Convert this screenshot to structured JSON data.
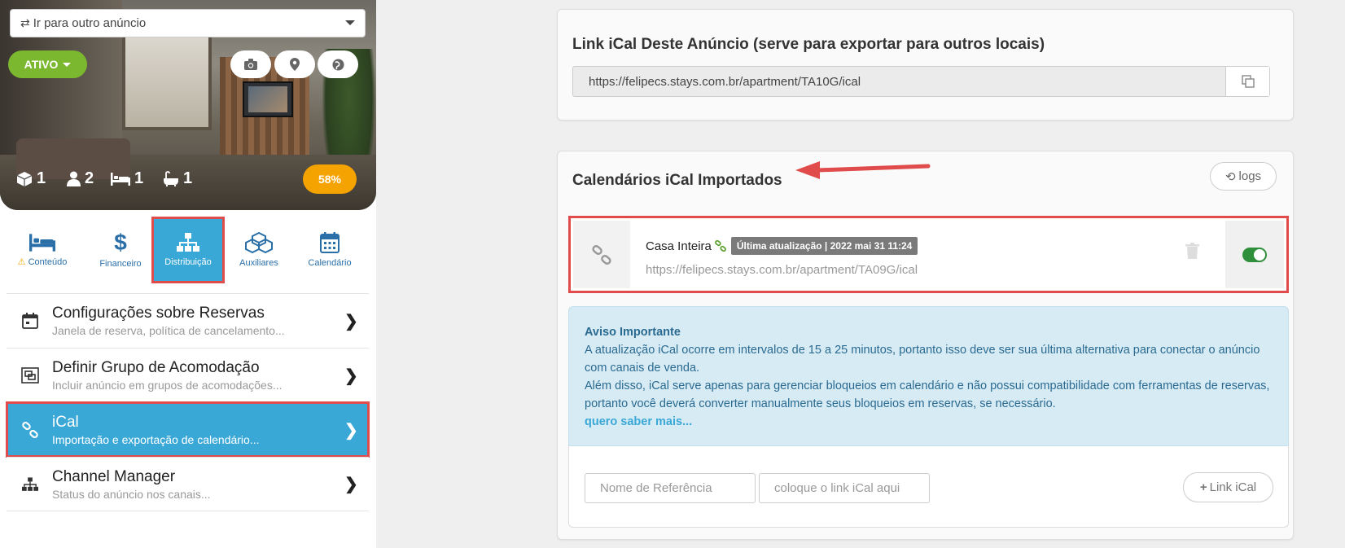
{
  "listing_selector": {
    "label": "Ir para outro anúncio"
  },
  "listing": {
    "status": "ATIVO",
    "stats": {
      "rooms": "1",
      "guests": "2",
      "beds": "1",
      "baths": "1"
    },
    "completion": "58%"
  },
  "tabs": [
    {
      "label": "Conteúdo",
      "icon": "bed-icon",
      "warning": true
    },
    {
      "label": "Financeiro",
      "icon": "dollar-icon",
      "warning": false
    },
    {
      "label": "Distribuição",
      "icon": "sitemap-icon",
      "warning": false,
      "active": true
    },
    {
      "label": "Auxiliares",
      "icon": "cubes-icon",
      "warning": false
    },
    {
      "label": "Calendário",
      "icon": "calendar-icon",
      "warning": false
    }
  ],
  "menu": [
    {
      "title": "Configurações sobre Reservas",
      "subtitle": "Janela de reserva, política de cancelamento...",
      "icon": "calendar-check-icon"
    },
    {
      "title": "Definir Grupo de Acomodação",
      "subtitle": "Incluir anúncio em grupos de acomodações...",
      "icon": "group-icon"
    },
    {
      "title": "iCal",
      "subtitle": "Importação e exportação de calendário...",
      "icon": "link-icon",
      "active": true
    },
    {
      "title": "Channel Manager",
      "subtitle": "Status do anúncio nos canais...",
      "icon": "sitemap-icon"
    }
  ],
  "export": {
    "title": "Link iCal Deste Anúncio (serve para exportar para outros locais)",
    "url": "https://felipecs.stays.com.br/apartment/TA10G/ical"
  },
  "import": {
    "title": "Calendários iCal Importados",
    "logs_label": "logs",
    "items": [
      {
        "name": "Casa Inteira",
        "badge": "Última atualização | 2022 mai 31 11:24",
        "url": "https://felipecs.stays.com.br/apartment/TA09G/ical",
        "enabled": true
      }
    ],
    "notice": {
      "title": "Aviso Importante",
      "line1": "A atualização iCal ocorre em intervalos de 15 a 25 minutos, portanto isso deve ser sua última alternativa para conectar o anúncio com canais de venda.",
      "line2": "Além disso, iCal serve apenas para gerenciar bloqueios em calendário e não possui compatibilidade com ferramentas de reservas, portanto você deverá converter manualmente seus bloqueios em reservas, se necessário.",
      "link": "quero saber mais..."
    },
    "form": {
      "name_placeholder": "Nome de Referência",
      "url_placeholder": "coloque o link iCal aqui",
      "add_label": "Link iCal"
    }
  },
  "colors": {
    "accent": "#3aa8d6",
    "status_green": "#7cb82f",
    "highlight_red": "#e04b4b",
    "completion_orange": "#f5a300"
  }
}
